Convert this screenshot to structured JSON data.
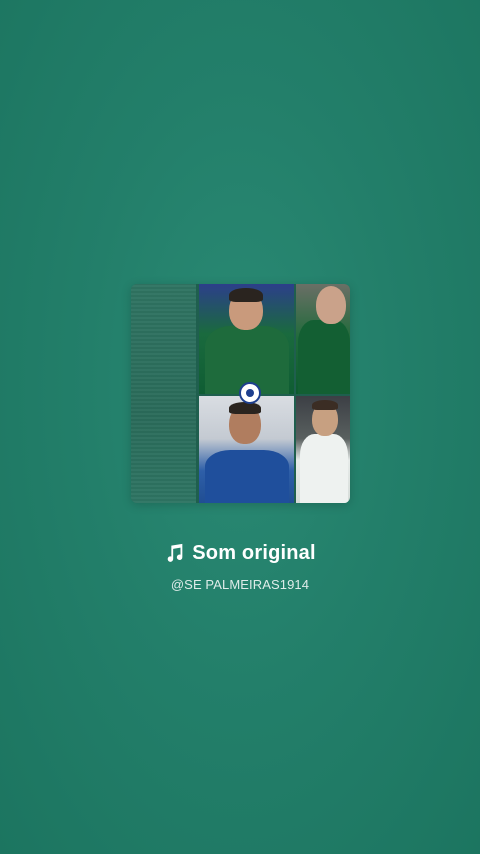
{
  "audio": {
    "title": "Som original",
    "author": "@SE PALMEIRAS1914",
    "icon": "music-note-icon"
  },
  "colors": {
    "background": "#237f6a",
    "text": "#ffffff"
  }
}
